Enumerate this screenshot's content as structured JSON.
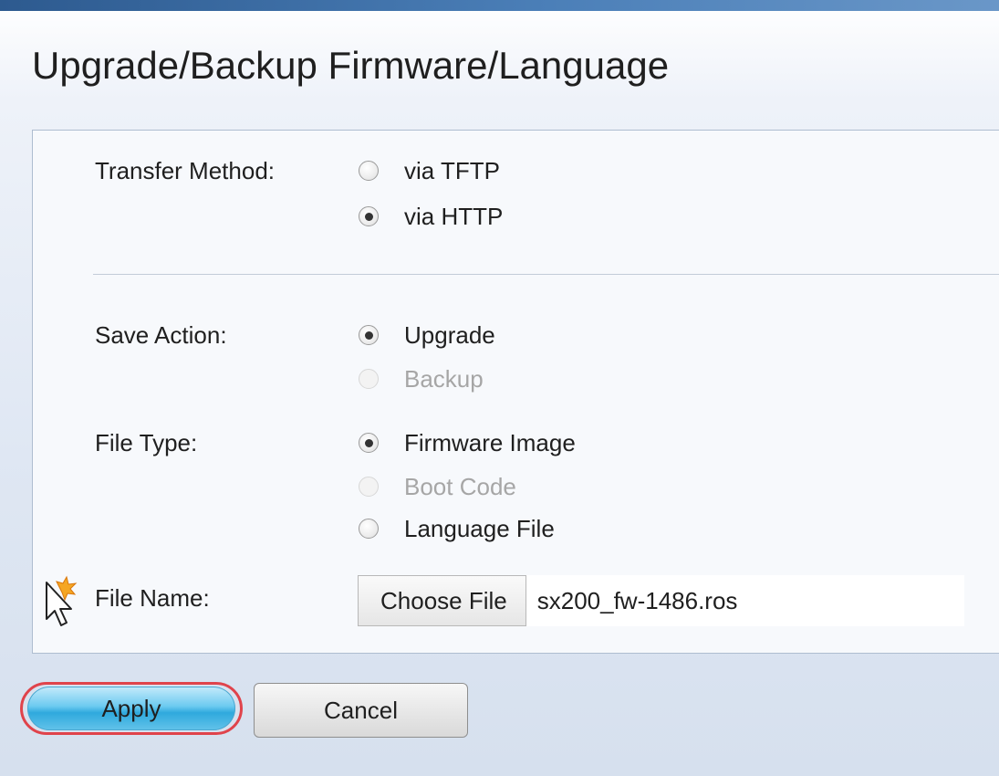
{
  "page": {
    "title": "Upgrade/Backup Firmware/Language"
  },
  "form": {
    "transfer_method": {
      "label": "Transfer Method:",
      "options": [
        {
          "label": "via TFTP",
          "selected": false,
          "enabled": true
        },
        {
          "label": "via HTTP",
          "selected": true,
          "enabled": true
        }
      ]
    },
    "save_action": {
      "label": "Save Action:",
      "options": [
        {
          "label": "Upgrade",
          "selected": true,
          "enabled": true
        },
        {
          "label": "Backup",
          "selected": false,
          "enabled": false
        }
      ]
    },
    "file_type": {
      "label": "File Type:",
      "options": [
        {
          "label": "Firmware Image",
          "selected": true,
          "enabled": true
        },
        {
          "label": "Boot Code",
          "selected": false,
          "enabled": false
        },
        {
          "label": "Language File",
          "selected": false,
          "enabled": true
        }
      ]
    },
    "file_name": {
      "label": "File Name:",
      "button_label": "Choose File",
      "value": "sx200_fw-1486.ros"
    }
  },
  "actions": {
    "apply_label": "Apply",
    "cancel_label": "Cancel"
  },
  "colors": {
    "header_bar": "#2d5a8f",
    "apply_highlight": "#e0434b",
    "apply_button": "#2fa9dd",
    "disabled_text": "#a6a6a6"
  },
  "icons": {
    "cursor": "pointer-cursor-icon"
  }
}
